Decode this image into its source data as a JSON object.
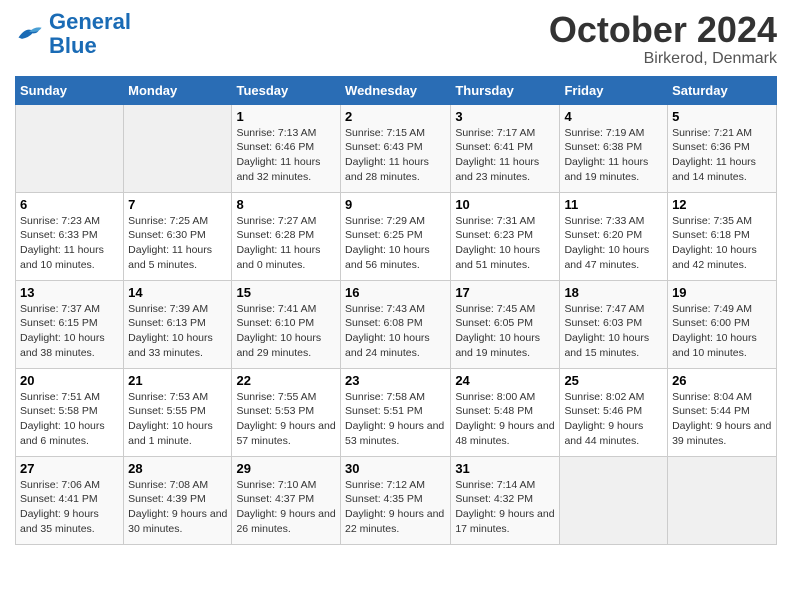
{
  "logo": {
    "line1": "General",
    "line2": "Blue"
  },
  "title": "October 2024",
  "location": "Birkerod, Denmark",
  "days_header": [
    "Sunday",
    "Monday",
    "Tuesday",
    "Wednesday",
    "Thursday",
    "Friday",
    "Saturday"
  ],
  "weeks": [
    [
      {
        "day": "",
        "sunrise": "",
        "sunset": "",
        "daylight": ""
      },
      {
        "day": "",
        "sunrise": "",
        "sunset": "",
        "daylight": ""
      },
      {
        "day": "1",
        "sunrise": "Sunrise: 7:13 AM",
        "sunset": "Sunset: 6:46 PM",
        "daylight": "Daylight: 11 hours and 32 minutes."
      },
      {
        "day": "2",
        "sunrise": "Sunrise: 7:15 AM",
        "sunset": "Sunset: 6:43 PM",
        "daylight": "Daylight: 11 hours and 28 minutes."
      },
      {
        "day": "3",
        "sunrise": "Sunrise: 7:17 AM",
        "sunset": "Sunset: 6:41 PM",
        "daylight": "Daylight: 11 hours and 23 minutes."
      },
      {
        "day": "4",
        "sunrise": "Sunrise: 7:19 AM",
        "sunset": "Sunset: 6:38 PM",
        "daylight": "Daylight: 11 hours and 19 minutes."
      },
      {
        "day": "5",
        "sunrise": "Sunrise: 7:21 AM",
        "sunset": "Sunset: 6:36 PM",
        "daylight": "Daylight: 11 hours and 14 minutes."
      }
    ],
    [
      {
        "day": "6",
        "sunrise": "Sunrise: 7:23 AM",
        "sunset": "Sunset: 6:33 PM",
        "daylight": "Daylight: 11 hours and 10 minutes."
      },
      {
        "day": "7",
        "sunrise": "Sunrise: 7:25 AM",
        "sunset": "Sunset: 6:30 PM",
        "daylight": "Daylight: 11 hours and 5 minutes."
      },
      {
        "day": "8",
        "sunrise": "Sunrise: 7:27 AM",
        "sunset": "Sunset: 6:28 PM",
        "daylight": "Daylight: 11 hours and 0 minutes."
      },
      {
        "day": "9",
        "sunrise": "Sunrise: 7:29 AM",
        "sunset": "Sunset: 6:25 PM",
        "daylight": "Daylight: 10 hours and 56 minutes."
      },
      {
        "day": "10",
        "sunrise": "Sunrise: 7:31 AM",
        "sunset": "Sunset: 6:23 PM",
        "daylight": "Daylight: 10 hours and 51 minutes."
      },
      {
        "day": "11",
        "sunrise": "Sunrise: 7:33 AM",
        "sunset": "Sunset: 6:20 PM",
        "daylight": "Daylight: 10 hours and 47 minutes."
      },
      {
        "day": "12",
        "sunrise": "Sunrise: 7:35 AM",
        "sunset": "Sunset: 6:18 PM",
        "daylight": "Daylight: 10 hours and 42 minutes."
      }
    ],
    [
      {
        "day": "13",
        "sunrise": "Sunrise: 7:37 AM",
        "sunset": "Sunset: 6:15 PM",
        "daylight": "Daylight: 10 hours and 38 minutes."
      },
      {
        "day": "14",
        "sunrise": "Sunrise: 7:39 AM",
        "sunset": "Sunset: 6:13 PM",
        "daylight": "Daylight: 10 hours and 33 minutes."
      },
      {
        "day": "15",
        "sunrise": "Sunrise: 7:41 AM",
        "sunset": "Sunset: 6:10 PM",
        "daylight": "Daylight: 10 hours and 29 minutes."
      },
      {
        "day": "16",
        "sunrise": "Sunrise: 7:43 AM",
        "sunset": "Sunset: 6:08 PM",
        "daylight": "Daylight: 10 hours and 24 minutes."
      },
      {
        "day": "17",
        "sunrise": "Sunrise: 7:45 AM",
        "sunset": "Sunset: 6:05 PM",
        "daylight": "Daylight: 10 hours and 19 minutes."
      },
      {
        "day": "18",
        "sunrise": "Sunrise: 7:47 AM",
        "sunset": "Sunset: 6:03 PM",
        "daylight": "Daylight: 10 hours and 15 minutes."
      },
      {
        "day": "19",
        "sunrise": "Sunrise: 7:49 AM",
        "sunset": "Sunset: 6:00 PM",
        "daylight": "Daylight: 10 hours and 10 minutes."
      }
    ],
    [
      {
        "day": "20",
        "sunrise": "Sunrise: 7:51 AM",
        "sunset": "Sunset: 5:58 PM",
        "daylight": "Daylight: 10 hours and 6 minutes."
      },
      {
        "day": "21",
        "sunrise": "Sunrise: 7:53 AM",
        "sunset": "Sunset: 5:55 PM",
        "daylight": "Daylight: 10 hours and 1 minute."
      },
      {
        "day": "22",
        "sunrise": "Sunrise: 7:55 AM",
        "sunset": "Sunset: 5:53 PM",
        "daylight": "Daylight: 9 hours and 57 minutes."
      },
      {
        "day": "23",
        "sunrise": "Sunrise: 7:58 AM",
        "sunset": "Sunset: 5:51 PM",
        "daylight": "Daylight: 9 hours and 53 minutes."
      },
      {
        "day": "24",
        "sunrise": "Sunrise: 8:00 AM",
        "sunset": "Sunset: 5:48 PM",
        "daylight": "Daylight: 9 hours and 48 minutes."
      },
      {
        "day": "25",
        "sunrise": "Sunrise: 8:02 AM",
        "sunset": "Sunset: 5:46 PM",
        "daylight": "Daylight: 9 hours and 44 minutes."
      },
      {
        "day": "26",
        "sunrise": "Sunrise: 8:04 AM",
        "sunset": "Sunset: 5:44 PM",
        "daylight": "Daylight: 9 hours and 39 minutes."
      }
    ],
    [
      {
        "day": "27",
        "sunrise": "Sunrise: 7:06 AM",
        "sunset": "Sunset: 4:41 PM",
        "daylight": "Daylight: 9 hours and 35 minutes."
      },
      {
        "day": "28",
        "sunrise": "Sunrise: 7:08 AM",
        "sunset": "Sunset: 4:39 PM",
        "daylight": "Daylight: 9 hours and 30 minutes."
      },
      {
        "day": "29",
        "sunrise": "Sunrise: 7:10 AM",
        "sunset": "Sunset: 4:37 PM",
        "daylight": "Daylight: 9 hours and 26 minutes."
      },
      {
        "day": "30",
        "sunrise": "Sunrise: 7:12 AM",
        "sunset": "Sunset: 4:35 PM",
        "daylight": "Daylight: 9 hours and 22 minutes."
      },
      {
        "day": "31",
        "sunrise": "Sunrise: 7:14 AM",
        "sunset": "Sunset: 4:32 PM",
        "daylight": "Daylight: 9 hours and 17 minutes."
      },
      {
        "day": "",
        "sunrise": "",
        "sunset": "",
        "daylight": ""
      },
      {
        "day": "",
        "sunrise": "",
        "sunset": "",
        "daylight": ""
      }
    ]
  ]
}
